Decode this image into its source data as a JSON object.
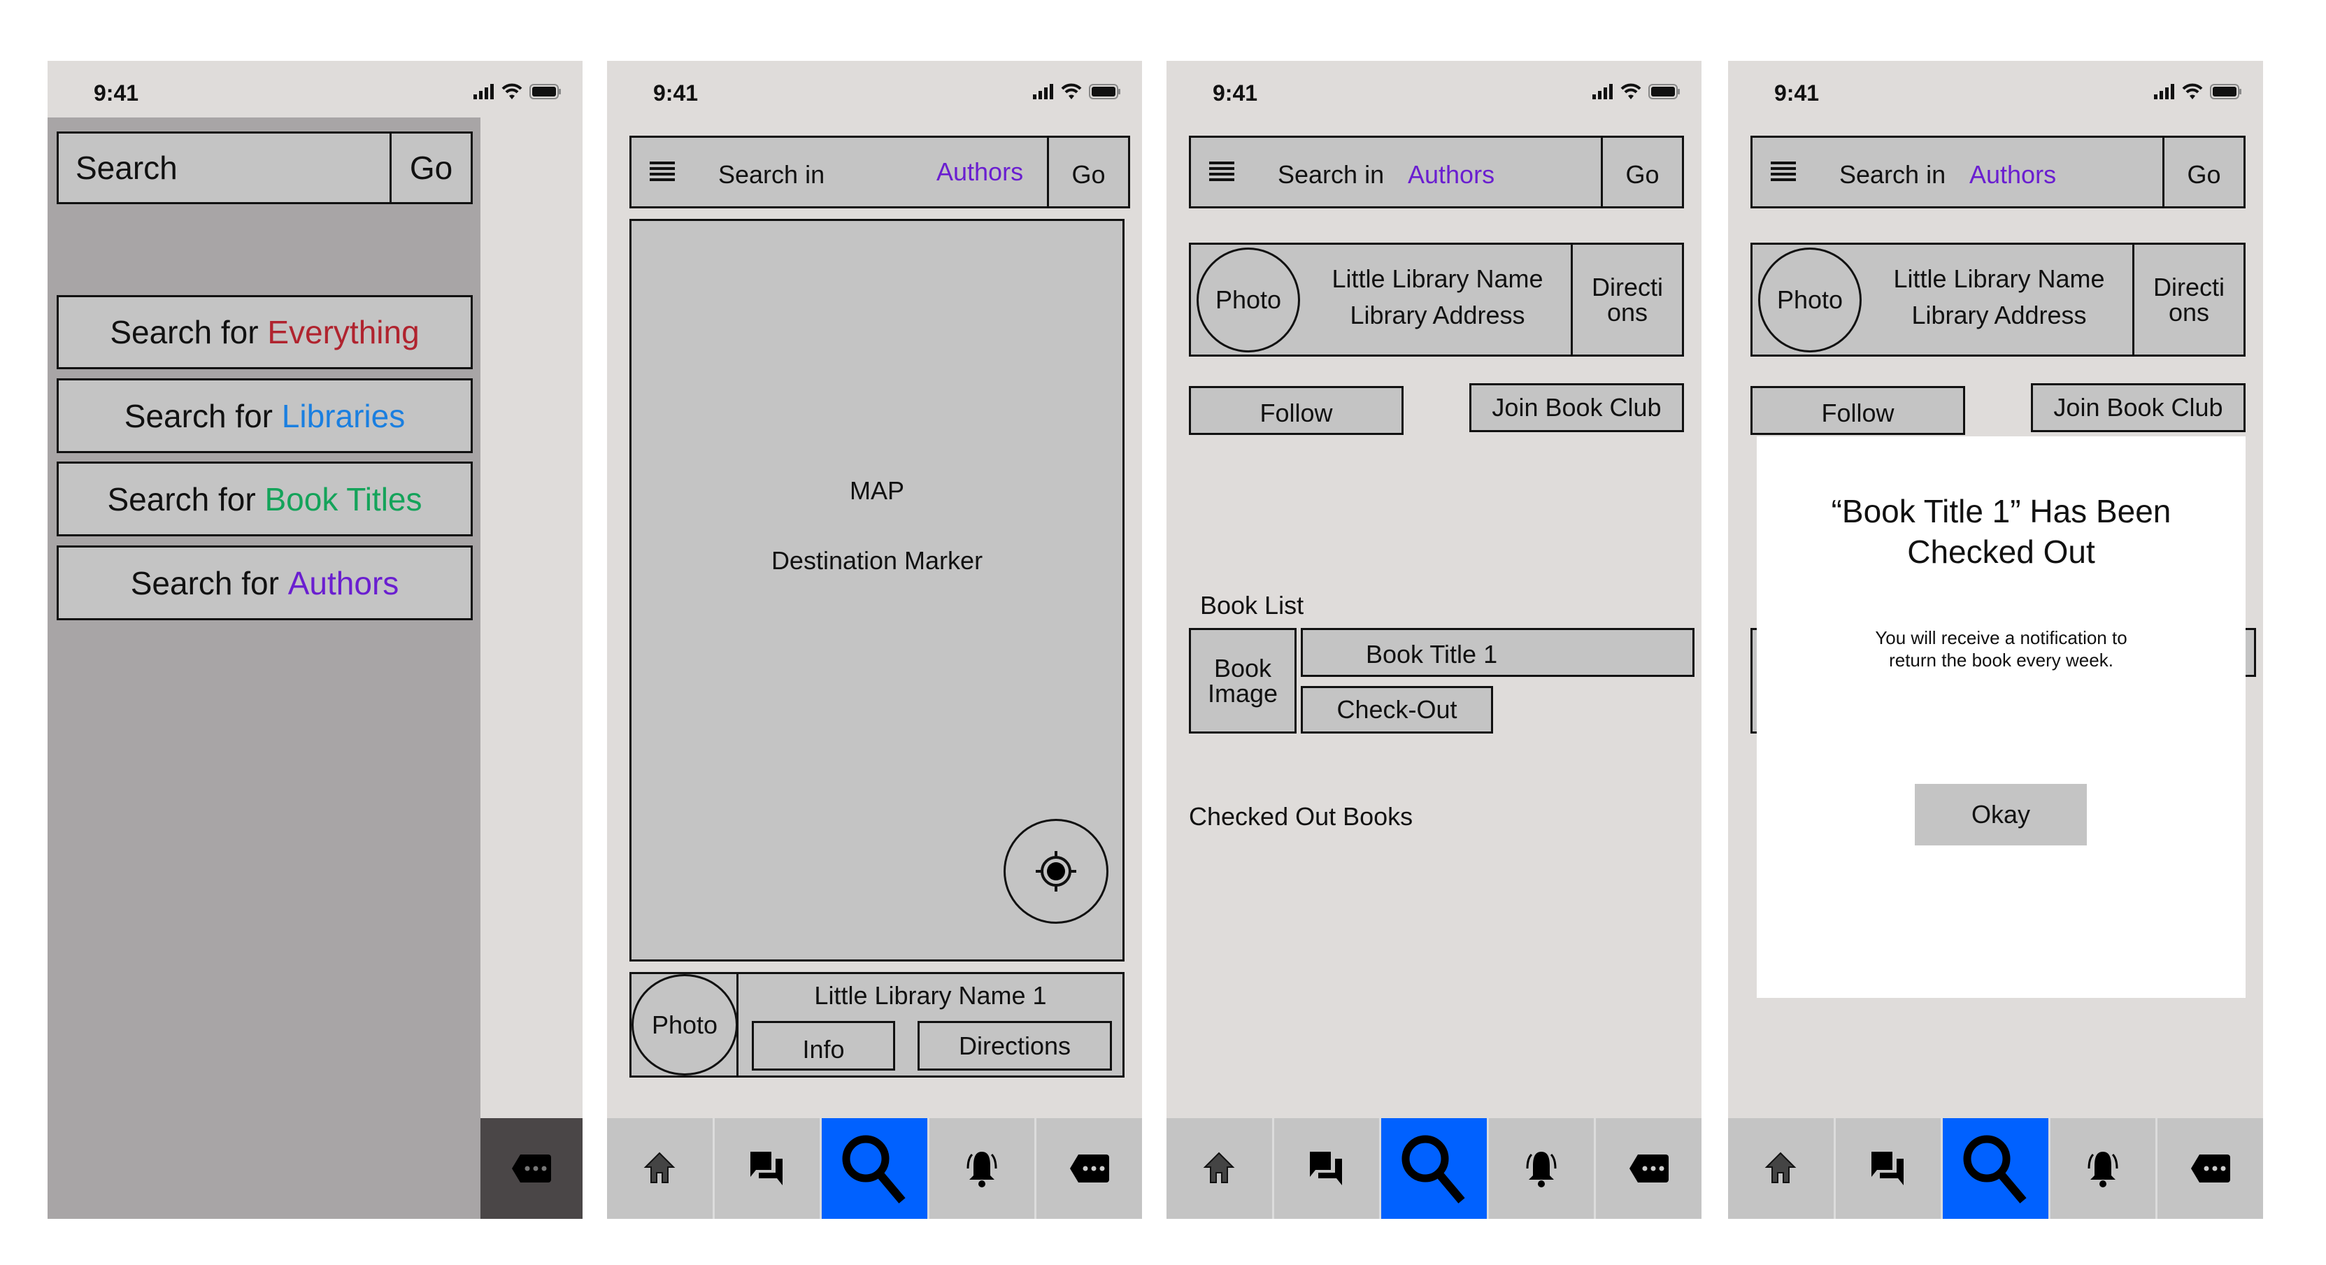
{
  "status_bar": {
    "time": "9:41",
    "icons": [
      "cellular-signal-icon",
      "wifi-icon",
      "battery-icon"
    ]
  },
  "colors": {
    "everything": "#b0232e",
    "libraries": "#1a7fe0",
    "book_titles": "#14a35a",
    "authors": "#6a1ed0",
    "active_tab": "#0061ff"
  },
  "screen1": {
    "search_placeholder": "Search",
    "go_label": "Go",
    "options": [
      {
        "prefix": "Search for ",
        "target": "Everything"
      },
      {
        "prefix": "Search for ",
        "target": "Libraries"
      },
      {
        "prefix": "Search for ",
        "target": "Book Titles"
      },
      {
        "prefix": "Search for ",
        "target": "Authors"
      }
    ],
    "more_icon": "more-tag-icon"
  },
  "search_bar": {
    "menu_icon": "hamburger-menu-icon",
    "label": "Search in",
    "scope": "Authors",
    "go_label": "Go"
  },
  "screen2": {
    "map_label": "MAP",
    "marker_label": "Destination Marker",
    "locate_icon": "locate-crosshair-icon",
    "card": {
      "photo_label": "Photo",
      "library_name": "Little Library Name 1",
      "info_label": "Info",
      "directions_label": "Directions"
    }
  },
  "screen3": {
    "library": {
      "photo_label": "Photo",
      "name": "Little Library Name",
      "address": "Library Address",
      "directions_line1": "Directi",
      "directions_line2": "ons"
    },
    "follow_label": "Follow",
    "join_label": "Join Book Club",
    "book_list_heading": "Book List",
    "book": {
      "image_line1": "Book",
      "image_line2": "Image",
      "title": "Book Title 1",
      "checkout_label": "Check-Out"
    },
    "checked_out_heading": "Checked Out Books"
  },
  "screen4": {
    "modal": {
      "title_line1": "“Book Title 1” Has Been",
      "title_line2": "Checked Out",
      "body_line1": "You will receive a notification to",
      "body_line2": "return the book every week.",
      "okay_label": "Okay"
    }
  },
  "tabs": [
    {
      "icon": "home-icon",
      "label": "Home"
    },
    {
      "icon": "chat-bubbles-icon",
      "label": "Messages"
    },
    {
      "icon": "search-icon",
      "label": "Search",
      "active": true
    },
    {
      "icon": "bell-icon",
      "label": "Notifications"
    },
    {
      "icon": "more-tag-icon",
      "label": "More"
    }
  ]
}
